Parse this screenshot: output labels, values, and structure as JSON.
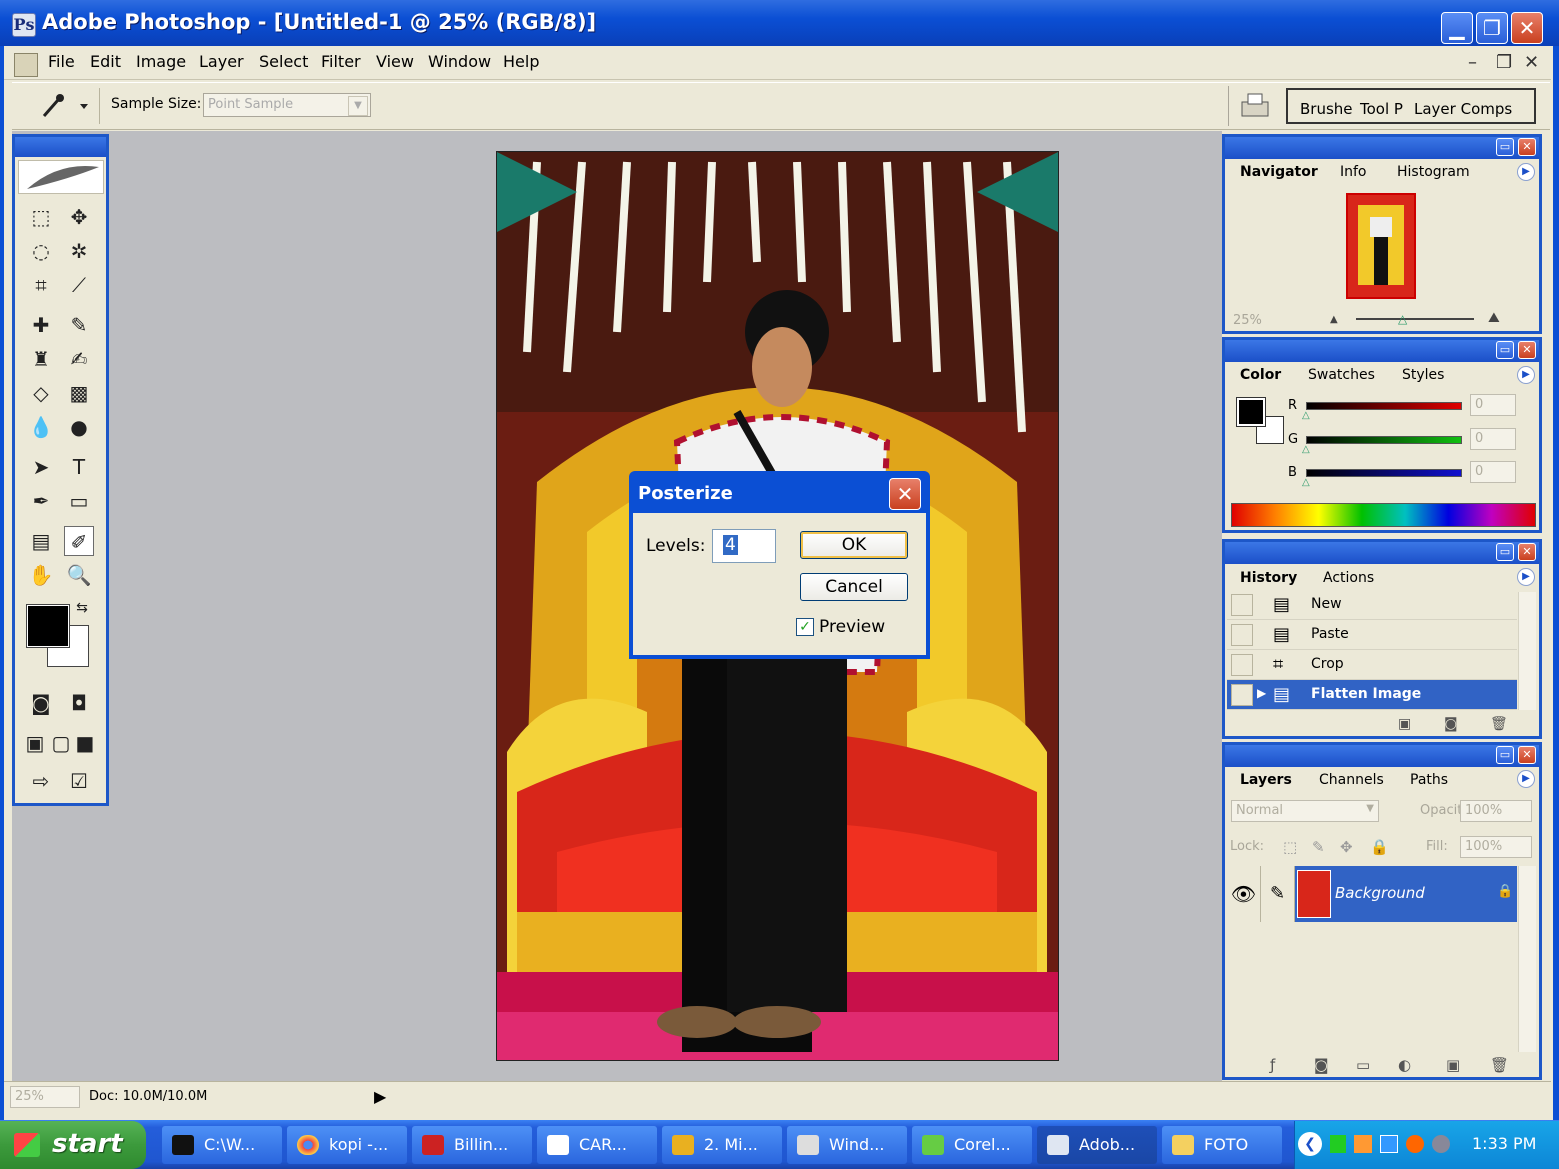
{
  "window": {
    "title": "Adobe Photoshop - [Untitled-1 @ 25% (RGB/8)]",
    "minimize": "▁",
    "maximize": "❐",
    "close": "✕"
  },
  "menu": [
    "File",
    "Edit",
    "Image",
    "Layer",
    "Select",
    "Filter",
    "View",
    "Window",
    "Help"
  ],
  "doc_controls": {
    "minimize": "–",
    "restore": "❐",
    "close": "✕"
  },
  "options_bar": {
    "sample_size_label": "Sample Size:",
    "sample_size_value": "Point Sample",
    "palette_well_tabs": [
      "Brushe",
      "Tool P",
      "Layer Comps"
    ]
  },
  "dialog": {
    "title": "Posterize",
    "levels_label": "Levels:",
    "levels_value": "4",
    "ok": "OK",
    "cancel": "Cancel",
    "preview_label": "Preview",
    "preview_checked": true
  },
  "navigator": {
    "tabs": [
      "Navigator",
      "Info",
      "Histogram"
    ],
    "zoom": "25%"
  },
  "color_panel": {
    "tabs": [
      "Color",
      "Swatches",
      "Styles"
    ],
    "sliders": [
      {
        "label": "R",
        "value": "0",
        "color": "#d01818"
      },
      {
        "label": "G",
        "value": "0",
        "color": "#18a018"
      },
      {
        "label": "B",
        "value": "0",
        "color": "#1818a0"
      }
    ],
    "foreground": "#000000",
    "background": "#ffffff"
  },
  "history": {
    "tabs": [
      "History",
      "Actions"
    ],
    "items": [
      "New",
      "Paste",
      "Crop",
      "Flatten Image"
    ],
    "selected_index": 3
  },
  "layers": {
    "tabs": [
      "Layers",
      "Channels",
      "Paths"
    ],
    "blend_mode": "Normal",
    "opacity_label": "Opacity:",
    "opacity": "100%",
    "lock_label": "Lock:",
    "fill_label": "Fill:",
    "fill": "100%",
    "layer_name": "Background"
  },
  "status": {
    "zoom": "25%",
    "doc": "Doc: 10.0M/10.0M"
  },
  "taskbar": {
    "start": "start",
    "tasks": [
      "C:\\W...",
      "kopi -...",
      "Billin...",
      "CAR...",
      "2. Mi...",
      "Wind...",
      "Corel...",
      "Adob...",
      "FOTO"
    ],
    "active_index": 7,
    "clock": "1:33 PM"
  },
  "colors": {
    "xp_blue": "#0b4fd4",
    "selection_blue": "#3163c5",
    "workspace": "#bcbdc1"
  }
}
